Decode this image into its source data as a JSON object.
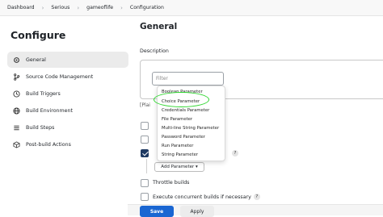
{
  "breadcrumb": [
    "Dashboard",
    "Serious",
    "gameoflife",
    "Configuration"
  ],
  "sidebar": {
    "title": "Configure",
    "items": [
      {
        "label": "General",
        "icon": "gear-icon"
      },
      {
        "label": "Source Code Management",
        "icon": "branch-icon"
      },
      {
        "label": "Build Triggers",
        "icon": "clock-icon"
      },
      {
        "label": "Build Environment",
        "icon": "globe-icon"
      },
      {
        "label": "Build Steps",
        "icon": "list-icon"
      },
      {
        "label": "Post-build Actions",
        "icon": "cube-icon"
      }
    ]
  },
  "main": {
    "title": "General",
    "description_label": "Description",
    "plain_text": "[Plai",
    "add_parameter": "Add Parameter ▾",
    "throttle_label": "Throttle builds",
    "concurrent_label": "Execute concurrent builds if necessary",
    "help_glyph": "?"
  },
  "dropdown": {
    "filter_placeholder": "Filter",
    "items": [
      "Boolean Parameter",
      "Choice Parameter",
      "Credentials Parameter",
      "File Parameter",
      "Multi-line String Parameter",
      "Password Parameter",
      "Run Parameter",
      "String Parameter"
    ]
  },
  "buttons": {
    "save": "Save",
    "apply": "Apply"
  },
  "colors": {
    "accent": "#1a66d2",
    "highlight": "#2fd62f",
    "checked": "#1f3a63"
  }
}
